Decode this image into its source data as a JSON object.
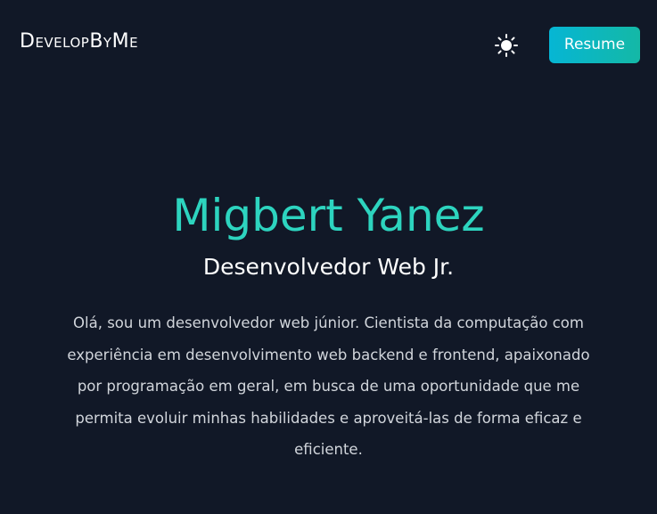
{
  "header": {
    "brand": "DevelopByMe",
    "theme_toggle_icon": "sun-icon",
    "resume_label": "Resume",
    "accent_gradient": [
      "#06b6d4",
      "#14b8a6"
    ]
  },
  "hero": {
    "name": "Migbert Yanez",
    "role": "Desenvolvedor Web Jr.",
    "bio": "Olá, sou um desenvolvedor web júnior. Cientista da computação com experiência em desenvolvimento web backend e frontend, apaixonado por programação em geral, em busca de uma oportunidade que me permita evoluir minhas habilidades e aproveitá-las de forma eficaz e eficiente.",
    "name_color": "#2dd4bf"
  },
  "colors": {
    "background": "#111827",
    "text": "#ffffff",
    "muted_text": "#d1d5db"
  }
}
